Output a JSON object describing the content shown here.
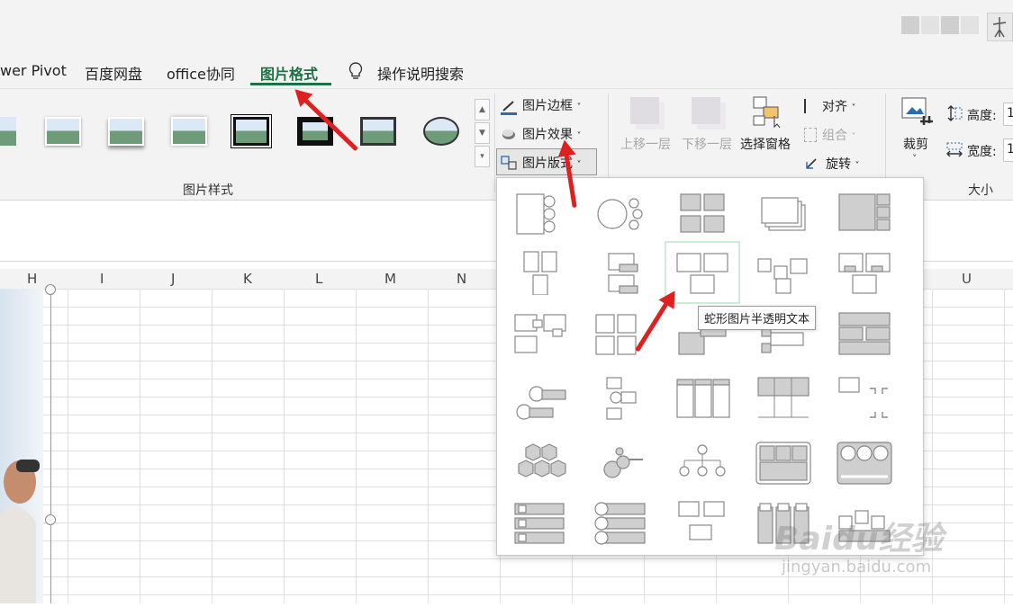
{
  "tabs": {
    "power_pivot": "wer Pivot",
    "baidu_drive": "百度网盘",
    "office_collab": "office协同",
    "picture_format": "图片格式",
    "tell_me": "操作说明搜索"
  },
  "ribbon": {
    "picture_styles_group": "图片样式",
    "picture_border": "图片边框",
    "picture_effects": "图片效果",
    "picture_layout": "图片版式",
    "bring_forward": "上移一层",
    "send_backward": "下移一层",
    "selection_pane": "选择窗格",
    "align": "对齐",
    "group": "组合",
    "rotate": "旋转",
    "crop": "裁剪",
    "height_label": "高度:",
    "height_value": "1",
    "width_label": "宽度:",
    "width_value": "1",
    "size_group": "大小",
    "dropdown_caret": "˅"
  },
  "columns": [
    "H",
    "I",
    "J",
    "K",
    "L",
    "M",
    "N",
    "U"
  ],
  "dropdown": {
    "tooltip": "蛇形图片半透明文本",
    "selected_index": 7
  },
  "watermark": {
    "brand": "Baidu经验",
    "url": "jingyan.baidu.com"
  },
  "colors": {
    "accent": "#1e7145",
    "arrow": "#e02020",
    "selected_cell": "#cdebd8"
  },
  "icons": [
    "picture-border-icon",
    "picture-effects-icon",
    "picture-layout-icon",
    "lightbulb-icon",
    "selection-pane-icon",
    "crop-icon",
    "height-icon",
    "width-icon"
  ]
}
